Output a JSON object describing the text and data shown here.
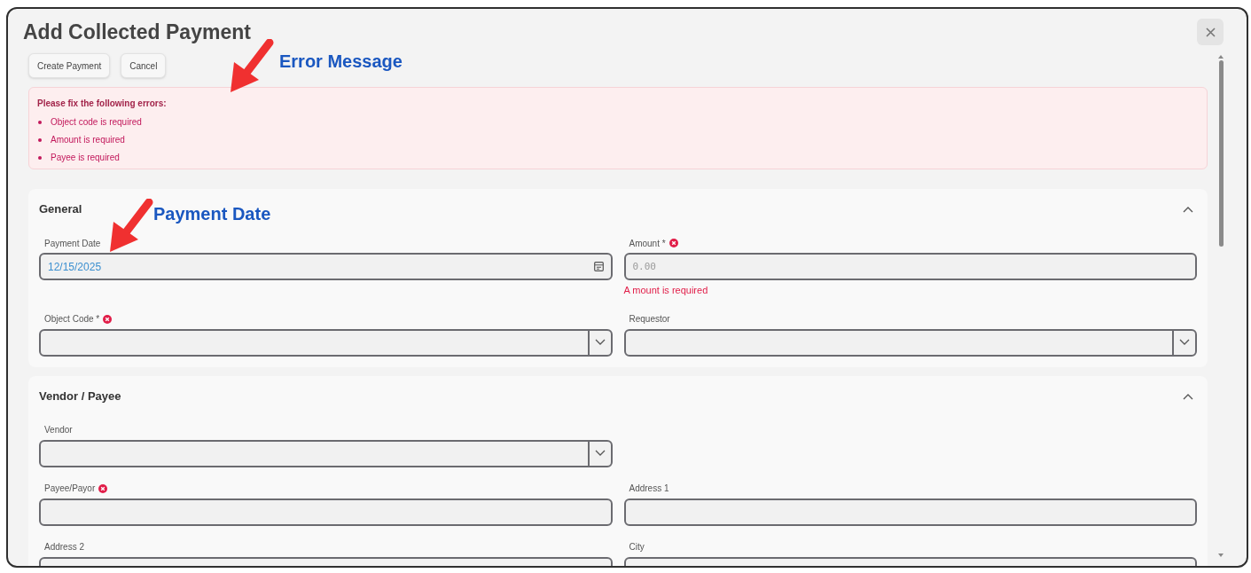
{
  "dialog": {
    "title": "Add Collected Payment"
  },
  "actions": [
    {
      "label": "Create Payment"
    },
    {
      "label": "Cancel"
    }
  ],
  "error_summary": {
    "heading": "Please fix the following errors:",
    "items": [
      "Object code is required",
      "Amount is required",
      "Payee is required"
    ]
  },
  "sections": [
    {
      "title": "General",
      "expanded": true,
      "rows": [
        [
          {
            "label": "Payment Date",
            "kind": "date",
            "invalid": false,
            "value": "12/15/2025"
          },
          {
            "label": "Amount *",
            "kind": "text",
            "invalid": true,
            "placeholder": "0.00",
            "error": "A mount is required"
          }
        ],
        [
          {
            "label": "Object Code *",
            "kind": "select",
            "invalid": true
          },
          {
            "label": "Requestor",
            "kind": "select",
            "invalid": false
          }
        ]
      ]
    },
    {
      "title": "Vendor / Payee",
      "expanded": true,
      "rows": [
        [
          {
            "label": "Vendor",
            "kind": "select",
            "invalid": false
          }
        ],
        [
          {
            "label": "Payee/Payor",
            "kind": "text",
            "invalid": true
          },
          {
            "label": "Address 1",
            "kind": "text",
            "invalid": false
          }
        ],
        [
          {
            "label": "Address 2",
            "kind": "text",
            "invalid": false
          },
          {
            "label": "City",
            "kind": "text",
            "invalid": false
          }
        ]
      ]
    }
  ],
  "annotations": [
    {
      "text": "Error Message"
    },
    {
      "text": "Payment Date"
    }
  ]
}
